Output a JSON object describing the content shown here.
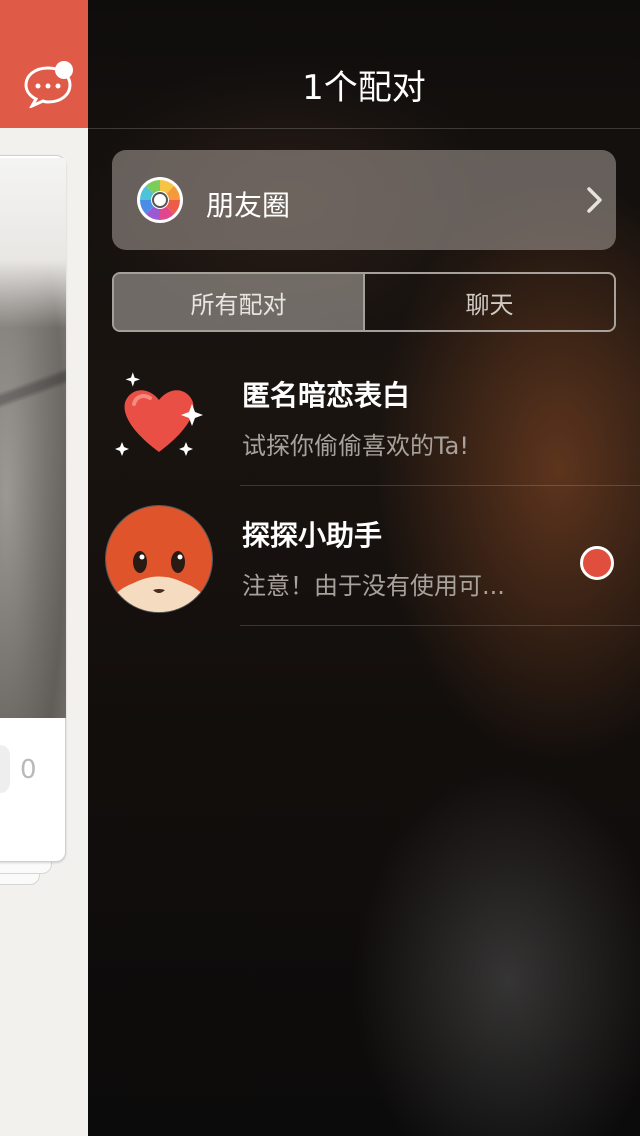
{
  "header": {
    "title": "1个配对"
  },
  "moments": {
    "label": "朋友圈",
    "icon": "color-wheel-icon"
  },
  "tabs": [
    {
      "label": "所有配对",
      "active": true
    },
    {
      "label": "聊天",
      "active": false
    }
  ],
  "matches": [
    {
      "name": "匿名暗恋表白",
      "message": "试探你偷偷喜欢的Ta!",
      "avatar": "sparkle-heart-icon",
      "unread": false
    },
    {
      "name": "探探小助手",
      "message": "注意！由于没有使用可...",
      "avatar": "fox-avatar",
      "unread": true
    }
  ],
  "background_card": {
    "count": "0"
  },
  "colors": {
    "accent": "#e05a48",
    "badge": "#e04e3e"
  }
}
